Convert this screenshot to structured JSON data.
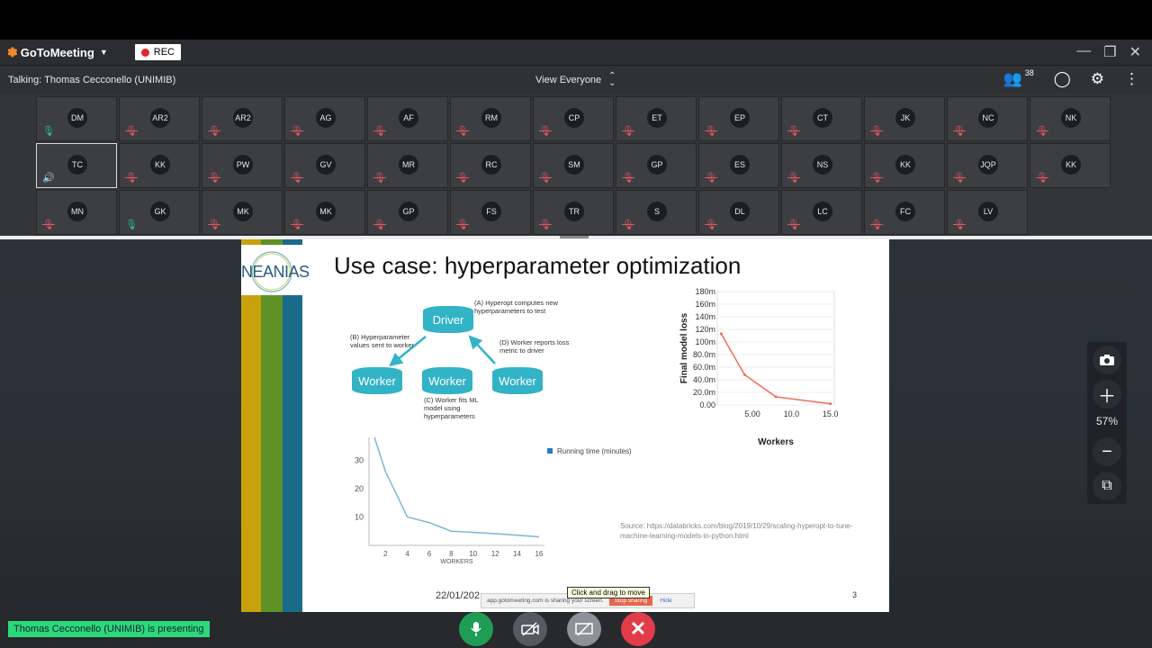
{
  "app": {
    "name": "GoToMeeting",
    "rec_label": "REC"
  },
  "window_controls": [
    "minimize-icon",
    "restore-icon",
    "close-icon"
  ],
  "toolbar": {
    "talking": "Talking: Thomas Cecconello (UNIMIB)",
    "view_label": "View Everyone",
    "attendee_count": "38"
  },
  "participants": [
    {
      "initials": "DM",
      "mic": "on"
    },
    {
      "initials": "AR2",
      "mic": "muted"
    },
    {
      "initials": "AR2",
      "mic": "muted"
    },
    {
      "initials": "AG",
      "mic": "muted"
    },
    {
      "initials": "AF",
      "mic": "muted"
    },
    {
      "initials": "RM",
      "mic": "muted"
    },
    {
      "initials": "CP",
      "mic": "muted"
    },
    {
      "initials": "ET",
      "mic": "muted"
    },
    {
      "initials": "EP",
      "mic": "muted"
    },
    {
      "initials": "CT",
      "mic": "muted"
    },
    {
      "initials": "JK",
      "mic": "muted"
    },
    {
      "initials": "NC",
      "mic": "muted"
    },
    {
      "initials": "NK",
      "mic": "muted"
    },
    {
      "initials": "TC",
      "mic": "speaking"
    },
    {
      "initials": "KK",
      "mic": "muted"
    },
    {
      "initials": "PW",
      "mic": "muted"
    },
    {
      "initials": "GV",
      "mic": "muted"
    },
    {
      "initials": "MR",
      "mic": "muted"
    },
    {
      "initials": "RC",
      "mic": "muted"
    },
    {
      "initials": "SM",
      "mic": "muted"
    },
    {
      "initials": "GP",
      "mic": "muted"
    },
    {
      "initials": "ES",
      "mic": "muted"
    },
    {
      "initials": "NS",
      "mic": "muted"
    },
    {
      "initials": "KK",
      "mic": "muted"
    },
    {
      "initials": "JQP",
      "mic": "muted"
    },
    {
      "initials": "KK",
      "mic": "muted"
    },
    {
      "initials": "MN",
      "mic": "muted"
    },
    {
      "initials": "GK",
      "mic": "on"
    },
    {
      "initials": "MK",
      "mic": "muted"
    },
    {
      "initials": "MK",
      "mic": "muted"
    },
    {
      "initials": "GP",
      "mic": "muted"
    },
    {
      "initials": "FS",
      "mic": "muted"
    },
    {
      "initials": "TR",
      "mic": "muted"
    },
    {
      "initials": "S",
      "mic": "muted"
    },
    {
      "initials": "DL",
      "mic": "muted"
    },
    {
      "initials": "LC",
      "mic": "muted"
    },
    {
      "initials": "FC",
      "mic": "muted"
    },
    {
      "initials": "LV",
      "mic": "muted"
    }
  ],
  "slide": {
    "logo_text": "NEANIAS",
    "title": "Use case: hyperparameter optimization",
    "diagram": {
      "driver": "Driver",
      "worker": "Worker",
      "note_a": "(A) Hyperopt computes new hyperparameters to test",
      "note_b": "(B) Hyperparameter values sent to worker",
      "note_c": "(C) Worker fits ML model using hyperparameters",
      "note_d": "(D) Worker reports loss metric to driver"
    },
    "source": "Source: https://databricks.com/blog/2019/10/29/scaling-hyperopt-to-tune-machine-learning-models-in-python.html",
    "date": "22/01/202",
    "page": "3"
  },
  "chart_data": [
    {
      "type": "line",
      "title": "",
      "xlabel": "Workers",
      "ylabel": "Final model loss",
      "x": [
        1,
        4,
        8,
        15
      ],
      "series": [
        {
          "values": [
            113,
            48,
            13,
            2
          ]
        }
      ],
      "xticks": [
        "5.00",
        "10.0",
        "15.0"
      ],
      "yticks": [
        "0.00",
        "20.0m",
        "40.0m",
        "60.0m",
        "80.0m",
        "100m",
        "120m",
        "140m",
        "160m",
        "180m"
      ],
      "xlim": [
        0.5,
        15.5
      ],
      "ylim": [
        0,
        180
      ],
      "color": "#f26b5b"
    },
    {
      "type": "line",
      "title": "",
      "xlabel": "WORKERS",
      "ylabel": "",
      "x": [
        1,
        2,
        4,
        6,
        8,
        10,
        12,
        14,
        16
      ],
      "series": [
        {
          "name": "Running time (minutes)",
          "values": [
            38,
            26,
            10,
            8,
            5,
            4.6,
            4.1,
            3.6,
            3.0
          ]
        }
      ],
      "xticks": [
        "2",
        "4",
        "6",
        "8",
        "10",
        "12",
        "14",
        "16"
      ],
      "yticks": [
        "10",
        "20",
        "30"
      ],
      "xlim": [
        0.5,
        16.5
      ],
      "ylim": [
        0,
        38
      ],
      "color": "#7ab7d6",
      "legend_color": "#2a7bbf"
    }
  ],
  "zoom": {
    "level": "57%"
  },
  "presenter_banner": "Thomas Cecconello (UNIMIB) is presenting",
  "tooltip": "Click and drag to move",
  "share_bar": {
    "text": "app.gotomeeting.com is sharing your screen.",
    "stop": "Stop sharing",
    "hide": "Hide"
  }
}
